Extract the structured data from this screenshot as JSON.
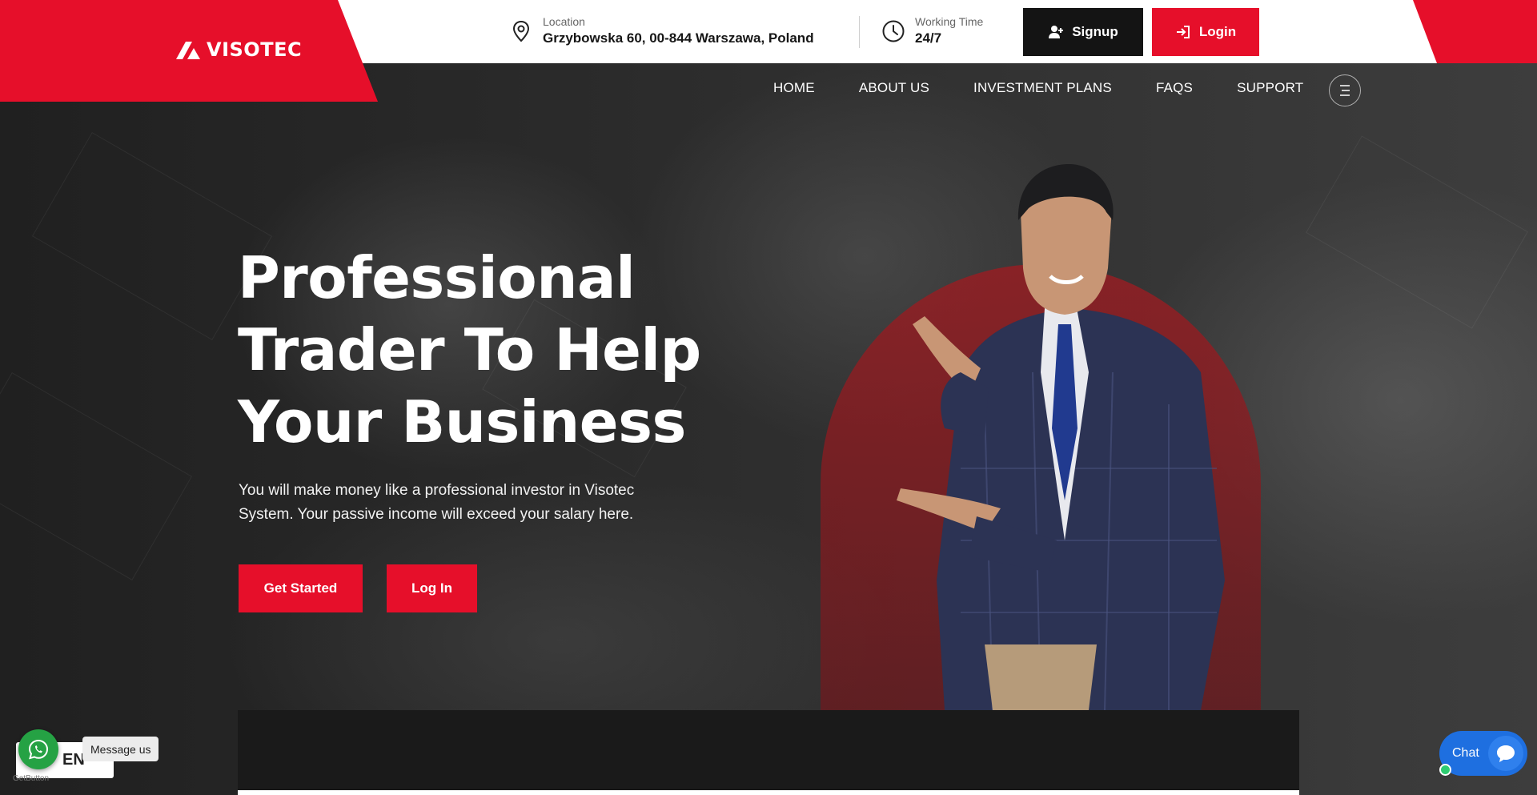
{
  "brand": {
    "name": "VISOTEC",
    "color": "#e60f2a"
  },
  "header": {
    "location_label": "Location",
    "location_value": "Grzybowska 60, 00-844 Warszawa, Poland",
    "time_label": "Working Time",
    "time_value": "24/7",
    "signup_label": "Signup",
    "login_label": "Login"
  },
  "nav": {
    "items": [
      "HOME",
      "ABOUT US",
      "INVESTMENT PLANS",
      "FAQS",
      "SUPPORT"
    ]
  },
  "hero": {
    "title_lines": [
      "Professional",
      "Trader To Help",
      "Your Business"
    ],
    "subtitle": "You will make money like a professional investor in Visotec System. Your passive income will exceed your salary here.",
    "btn_primary": "Get Started",
    "btn_secondary": "Log In"
  },
  "widgets": {
    "language": "EN",
    "whatsapp_tip": "Message us",
    "getbutton": "GetButton",
    "chat_label": "Chat"
  },
  "icons": {
    "location": "map-pin-icon",
    "time": "clock-icon",
    "signup": "user-plus-icon",
    "login": "sign-in-icon",
    "menu": "hamburger-icon",
    "whatsapp": "whatsapp-icon",
    "chat": "chat-bubble-icon"
  }
}
